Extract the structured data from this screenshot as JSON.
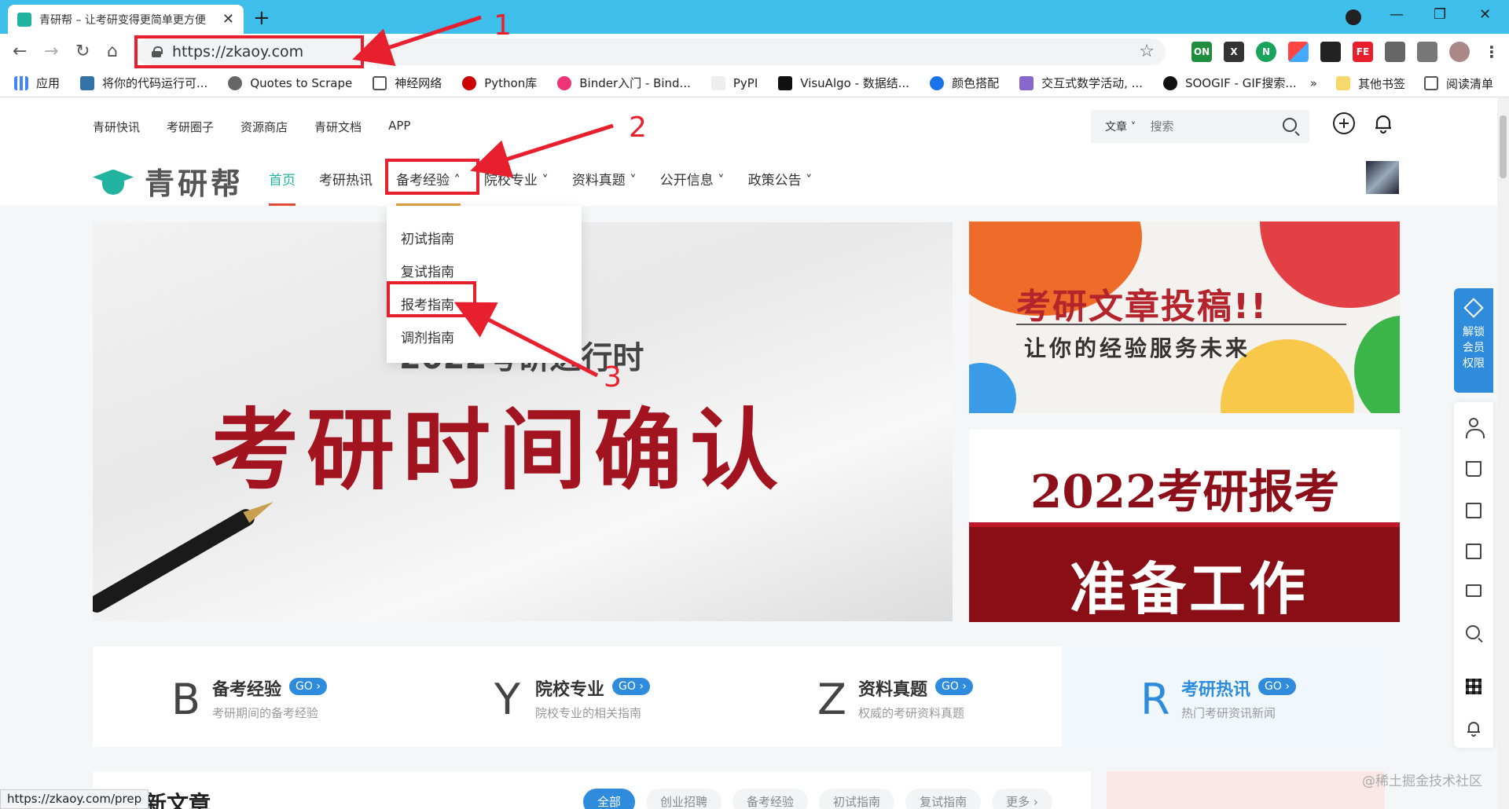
{
  "browser": {
    "tab_title": "青研帮 – 让考研变得更简单更方便",
    "url": "https://zkaoy.com",
    "status_url": "https://zkaoy.com/prep",
    "bookmarks": [
      "应用",
      "将你的代码运行可...",
      "Quotes to Scrape",
      "神经网络",
      "Python库",
      "Binder入门 - Bind...",
      "PyPI",
      "VisuAlgo - 数据结...",
      "颜色搭配",
      "交互式数学活动, ...",
      "SOOGIF - GIF搜索..."
    ],
    "bookmarks_overflow": "»",
    "other_bookmarks": "其他书签",
    "reading_list": "阅读清单"
  },
  "site": {
    "topnav": [
      "青研快讯",
      "考研圈子",
      "资源商店",
      "青研文档",
      "APP"
    ],
    "search": {
      "select": "文章",
      "placeholder": "搜索"
    },
    "logo_text": "青研帮",
    "mainnav": [
      {
        "label": "首页",
        "active": true
      },
      {
        "label": "考研热讯"
      },
      {
        "label": "备考经验",
        "open": true
      },
      {
        "label": "院校专业"
      },
      {
        "label": "资料真题"
      },
      {
        "label": "公开信息"
      },
      {
        "label": "政策公告"
      }
    ],
    "dropdown": [
      "初试指南",
      "复试指南",
      "报考指南",
      "调剂指南"
    ]
  },
  "banners": {
    "main_sub": "2022考研进行时",
    "main_title": "考研时间确认",
    "right1_title": "考研文章投稿!!",
    "right1_sub": "让你的经验服务未来",
    "right2_year": "2022考研报考",
    "right2_band": "准备工作"
  },
  "categories": [
    {
      "letter": "B",
      "name": "备考经验",
      "go": "GO ›",
      "desc": "考研期间的备考经验"
    },
    {
      "letter": "Y",
      "name": "院校专业",
      "go": "GO ›",
      "desc": "院校专业的相关指南"
    },
    {
      "letter": "Z",
      "name": "资料真题",
      "go": "GO ›",
      "desc": "权威的考研资料真题"
    },
    {
      "letter": "R",
      "name": "考研热讯",
      "go": "GO ›",
      "desc": "热门考研资讯新闻"
    }
  ],
  "articles": {
    "heading": "新文章",
    "tabs": [
      "全部",
      "创业招聘",
      "备考经验",
      "初试指南",
      "复试指南",
      "更多 ›"
    ]
  },
  "sidebar": {
    "vip_text": "解锁会员权限"
  },
  "annotations": [
    "1",
    "2",
    "3"
  ],
  "watermark": "@稀土掘金技术社区",
  "colors": {
    "brand": "#21b2a0",
    "accent_blue": "#2f8cdc",
    "annotation_red": "#e8202e",
    "tabbar": "#3ebeea"
  }
}
